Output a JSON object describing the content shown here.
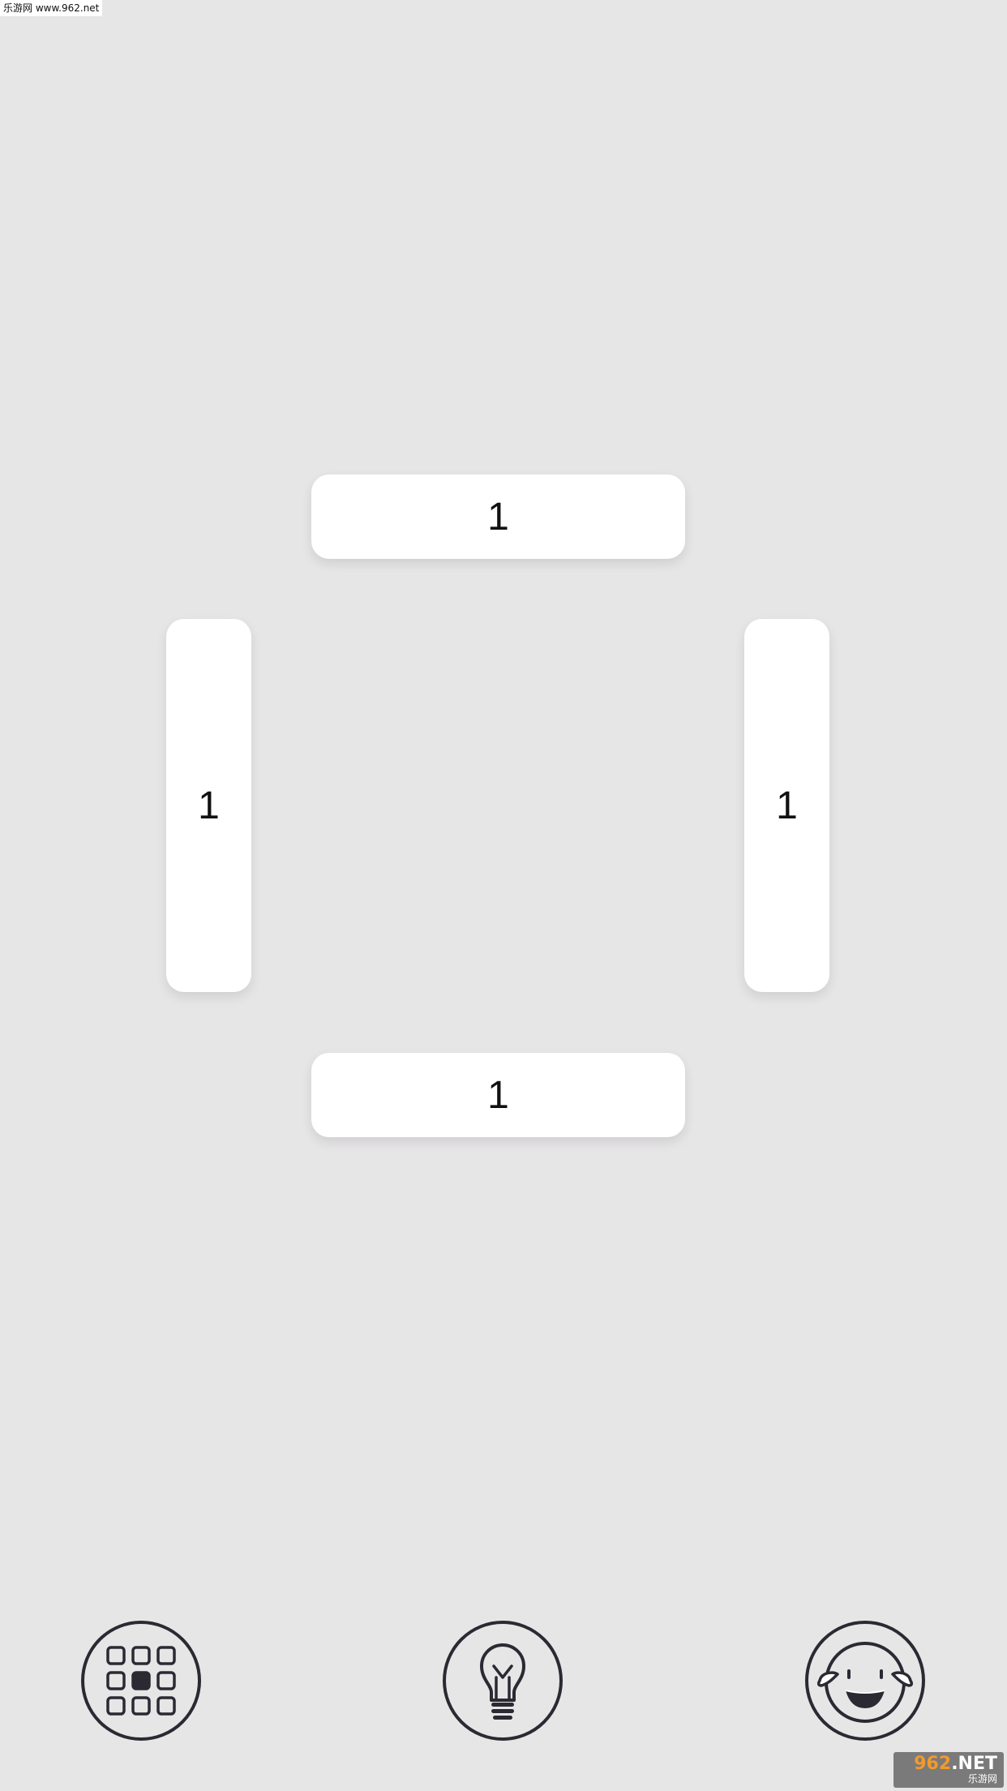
{
  "watermark": {
    "top_text": "乐游网 www.962.net",
    "bottom_digits": "962",
    "bottom_suffix": ".NET",
    "bottom_sub": "乐游网"
  },
  "board": {
    "tiles": [
      {
        "id": "top",
        "value": "1"
      },
      {
        "id": "left",
        "value": "1"
      },
      {
        "id": "right",
        "value": "1"
      },
      {
        "id": "bottom",
        "value": "1"
      }
    ]
  },
  "toolbar": {
    "buttons": [
      {
        "id": "levels",
        "icon": "level-grid-icon"
      },
      {
        "id": "hint",
        "icon": "lightbulb-icon"
      },
      {
        "id": "share",
        "icon": "laughing-face-icon"
      }
    ]
  },
  "colors": {
    "background": "#e7e6e7",
    "tile": "#ffffff",
    "icon_stroke": "#2b2a33"
  }
}
